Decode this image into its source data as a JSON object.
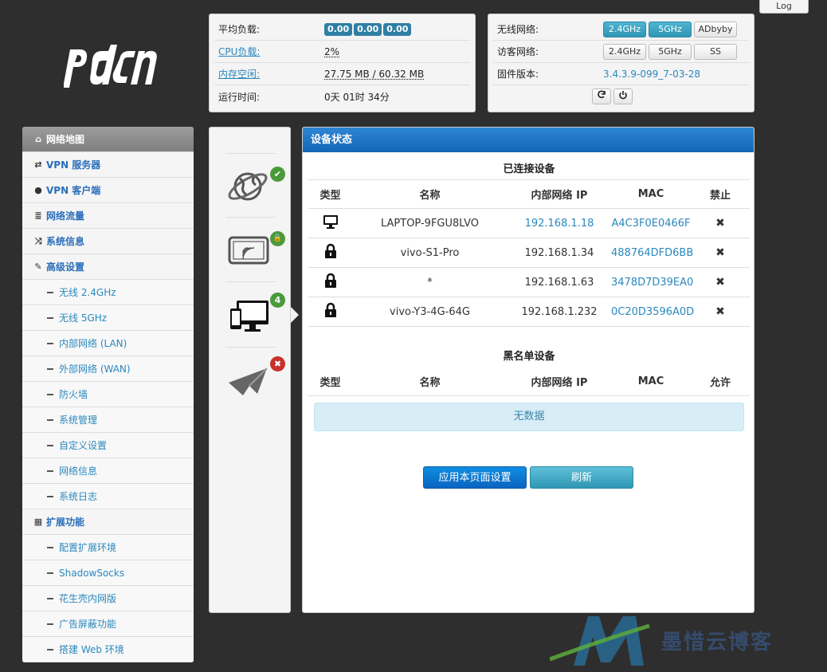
{
  "header": {
    "logout_label": "Log",
    "logo_text": "pdcn"
  },
  "status_left": {
    "load_label": "平均负载:",
    "load_values": [
      "0.00",
      "0.00",
      "0.00"
    ],
    "cpu_label": "CPU负载:",
    "cpu_value": "2%",
    "mem_label": "内存空闲:",
    "mem_value": "27.75 MB / 60.32 MB",
    "uptime_label": "运行时间:",
    "uptime_value": "0天 01时 34分"
  },
  "status_right": {
    "wireless_label": "无线网络:",
    "wireless_buttons": [
      "2.4GHz",
      "5GHz",
      "ADbyby"
    ],
    "guest_label": "访客网络:",
    "guest_buttons": [
      "2.4GHz",
      "5GHz",
      "SS"
    ],
    "firmware_label": "固件版本:",
    "firmware_value": "3.4.3.9-099_7-03-28"
  },
  "sidebar": {
    "items": [
      {
        "label": "网络地图",
        "icon": "home-icon"
      },
      {
        "label": "VPN 服务器",
        "icon": "retweet-icon"
      },
      {
        "label": "VPN 客户端",
        "icon": "globe-icon"
      },
      {
        "label": "网络流量",
        "icon": "list-icon"
      },
      {
        "label": "系统信息",
        "icon": "random-icon"
      },
      {
        "label": "高级设置",
        "icon": "wrench-icon"
      }
    ],
    "advanced_sub": [
      "无线 2.4GHz",
      "无线 5GHz",
      "内部网络 (LAN)",
      "外部网络 (WAN)",
      "防火墙",
      "系统管理",
      "自定义设置",
      "网络信息",
      "系统日志"
    ],
    "ext_label": "扩展功能",
    "ext_sub": [
      "配置扩展环境",
      "ShadowSocks",
      "花生壳内网版",
      "广告屏蔽功能",
      "搭建 Web 环境"
    ]
  },
  "network_map": {
    "client_count": "4"
  },
  "main": {
    "title": "设备状态",
    "connected_title": "已连接设备",
    "columns": [
      "类型",
      "名称",
      "内部网络 IP",
      "MAC",
      "禁止"
    ],
    "devices": [
      {
        "type_icon": "desktop-icon",
        "name": "LAPTOP-9FGU8LVO",
        "ip": "192.168.1.18",
        "mac": "A4C3F0E0466F"
      },
      {
        "type_icon": "lock-icon",
        "name": "vivo-S1-Pro",
        "ip": "192.168.1.34",
        "mac": "488764DFD6BB"
      },
      {
        "type_icon": "lock-icon",
        "name": "*",
        "ip": "192.168.1.63",
        "mac": "3478D7D39EA0"
      },
      {
        "type_icon": "lock-icon",
        "name": "vivo-Y3-4G-64G",
        "ip": "192.168.1.232",
        "mac": "0C20D3596A0D"
      }
    ],
    "block_mark": "✖",
    "blacklist_title": "黑名单设备",
    "blacklist_columns": [
      "类型",
      "名称",
      "内部网络 IP",
      "MAC",
      "允许"
    ],
    "no_data": "无数据",
    "apply_label": "应用本页面设置",
    "refresh_label": "刷新"
  },
  "watermark": {
    "text": "墨惜云博客"
  }
}
